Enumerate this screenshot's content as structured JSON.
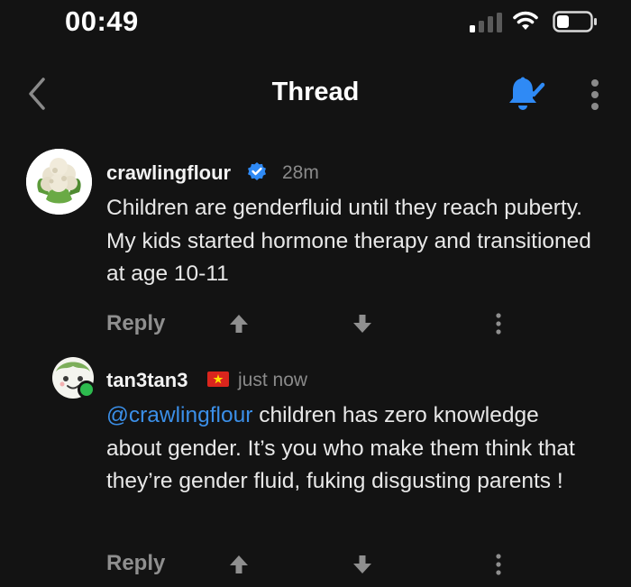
{
  "status_bar": {
    "time": "00:49"
  },
  "nav": {
    "title": "Thread"
  },
  "comments": [
    {
      "username": "crawlingflour",
      "verified": true,
      "time": "28m",
      "text": "Children are genderfluid until they reach puberty. My kids started hormone therapy and transitioned at age 10-11",
      "reply_label": "Reply",
      "avatar_icon": "cauliflower-avatar"
    },
    {
      "username": "tan3tan3",
      "flag_icon": "vietnam-flag-icon",
      "time": "just now",
      "mention": "@crawlingflour",
      "text": " children has zero knowledge about gender. It’s you who make them think that they’re gender fluid, fuking disgusting parents !",
      "reply_label": "Reply",
      "online": true,
      "avatar_icon": "cartoon-avatar"
    }
  ],
  "colors": {
    "accent": "#2f8af5",
    "background": "#131313"
  }
}
